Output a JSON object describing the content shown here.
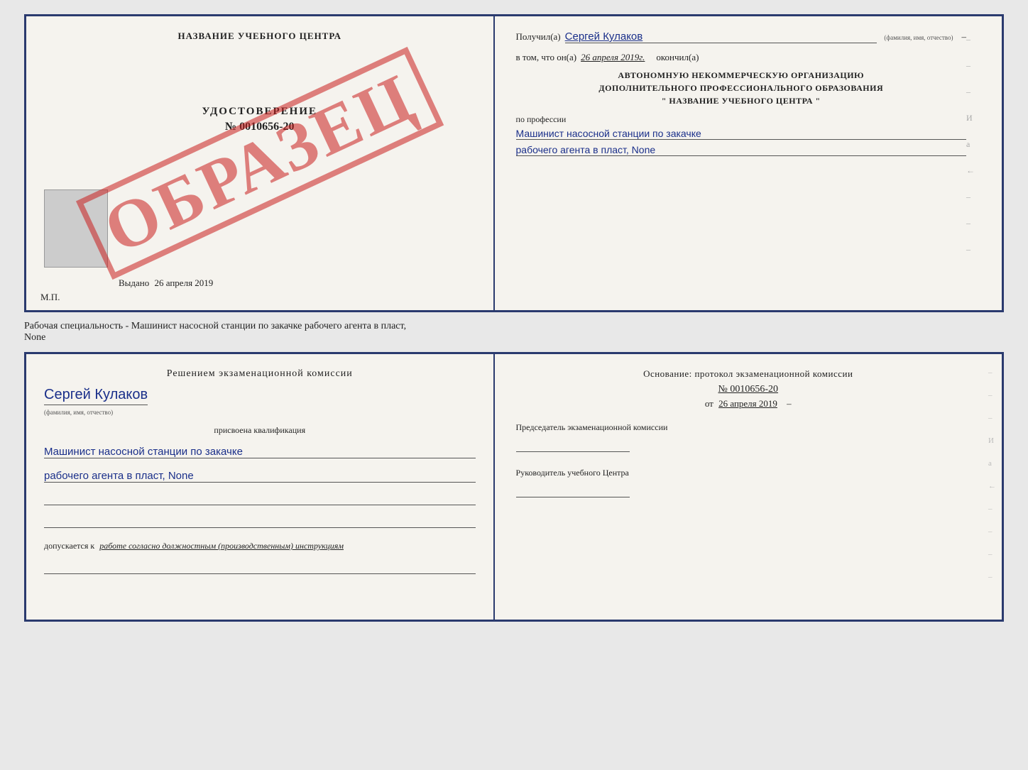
{
  "topDoc": {
    "left": {
      "centerTitle": "НАЗВАНИЕ УЧЕБНОГО ЦЕНТРА",
      "stamp": "ОБРАЗЕЦ",
      "certTitle": "УДОСТОВЕРЕНИЕ",
      "certNumber": "№ 0010656-20",
      "issuedLabel": "Выдано",
      "issuedDate": "26 апреля 2019",
      "mpLabel": "М.П."
    },
    "right": {
      "receivedLabel": "Получил(а)",
      "receivedName": "Сергей Кулаков",
      "nameSub": "(фамилия, имя, отчество)",
      "inThatLabel": "в том, что он(а)",
      "inThatDate": "26 апреля 2019г.",
      "finishedLabel": "окончил(а)",
      "orgLine1": "АВТОНОМНУЮ НЕКОММЕРЧЕСКУЮ ОРГАНИЗАЦИЮ",
      "orgLine2": "ДОПОЛНИТЕЛЬНОГО ПРОФЕССИОНАЛЬНОГО ОБРАЗОВАНИЯ",
      "orgLine3": "\"   НАЗВАНИЕ УЧЕБНОГО ЦЕНТРА   \"",
      "profLabel": "по профессии",
      "profValue1": "Машинист насосной станции по закачке",
      "profValue2": "рабочего агента в пласт, None",
      "dash": "–",
      "dashes": [
        "–",
        "–",
        "–",
        "И",
        "а",
        "←",
        "–",
        "–",
        "–"
      ]
    }
  },
  "descriptionLine": "Рабочая специальность - Машинист насосной станции по закачке рабочего агента в пласт,",
  "descriptionLine2": "None",
  "bottomDoc": {
    "left": {
      "decisionTitle": "Решением экзаменационной комиссии",
      "personName": "Сергей Кулаков",
      "nameSub": "(фамилия, имя, отчество)",
      "assignedLabel": "присвоена квалификация",
      "qualValue1": "Машинист насосной станции по закачке",
      "qualValue2": "рабочего агента в пласт, None",
      "admitsLabel": "допускается к",
      "admitsValue": "работе согласно должностным (производственным) инструкциям"
    },
    "right": {
      "basisTitle": "Основание: протокол экзаменационной комиссии",
      "protocolNumber": "№ 0010656-20",
      "protocolDatePre": "от",
      "protocolDate": "26 апреля 2019",
      "chairmanLabel": "Председатель экзаменационной комиссии",
      "headLabel": "Руководитель учебного Центра",
      "dashes": [
        "–",
        "–",
        "–",
        "И",
        "а",
        "←",
        "–",
        "–",
        "–",
        "–"
      ]
    }
  }
}
